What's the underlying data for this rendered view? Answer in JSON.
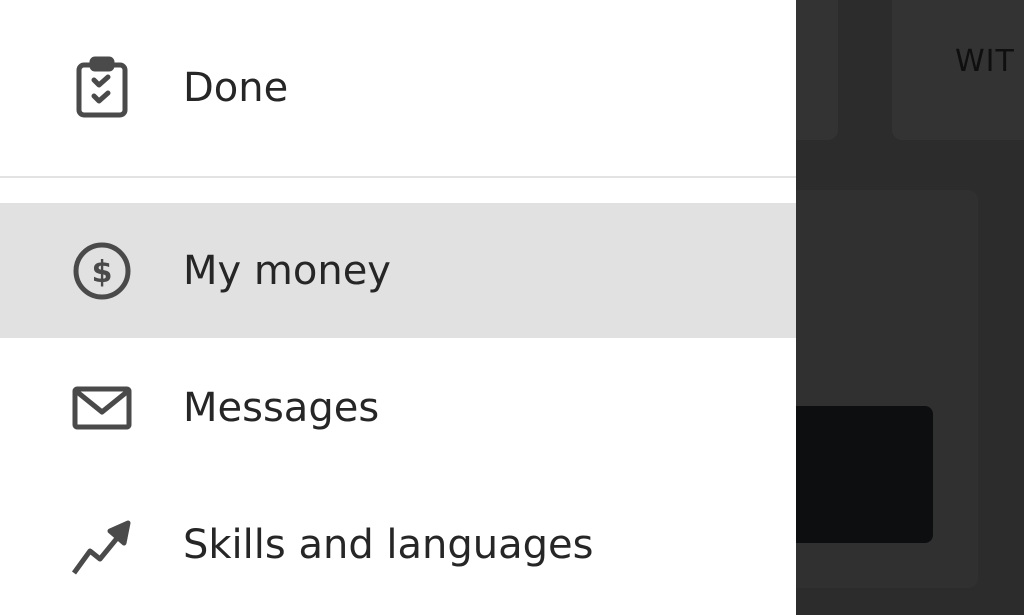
{
  "drawer": {
    "items": [
      {
        "label": "Done",
        "icon": "clipboard-check-icon",
        "selected": false
      },
      {
        "label": "My money",
        "icon": "dollar-circle-icon",
        "selected": true
      },
      {
        "label": "Messages",
        "icon": "envelope-icon",
        "selected": false
      },
      {
        "label": "Skills and languages",
        "icon": "trending-up-icon",
        "selected": false
      }
    ]
  },
  "background": {
    "tab_label": "WIT"
  },
  "colors": {
    "drawer_bg": "#ffffff",
    "selected_bg": "#e1e1e1",
    "text": "#262626",
    "icon": "#4a4a4a",
    "overlay_bg": "#2c2c2c"
  }
}
